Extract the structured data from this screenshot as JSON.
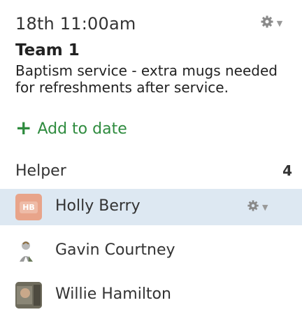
{
  "date": {
    "title": "18th 11:00am"
  },
  "team": {
    "name": "Team 1",
    "notes": "Baptism service - extra mugs needed for refreshments after service."
  },
  "add_to_date": {
    "label": "Add to date"
  },
  "role": {
    "title": "Helper",
    "count": "4"
  },
  "people": [
    {
      "name": "Holly Berry",
      "initials": "HB",
      "selected": true
    },
    {
      "name": "Gavin Courtney"
    },
    {
      "name": "Willie Hamilton"
    }
  ],
  "colors": {
    "accent_green": "#2e8b3e",
    "selected_row": "#dde8f2",
    "initials_avatar": "#e8a48a"
  },
  "icons": {
    "settings": "gear-icon",
    "dropdown": "caret-down-icon",
    "add": "plus-icon"
  }
}
